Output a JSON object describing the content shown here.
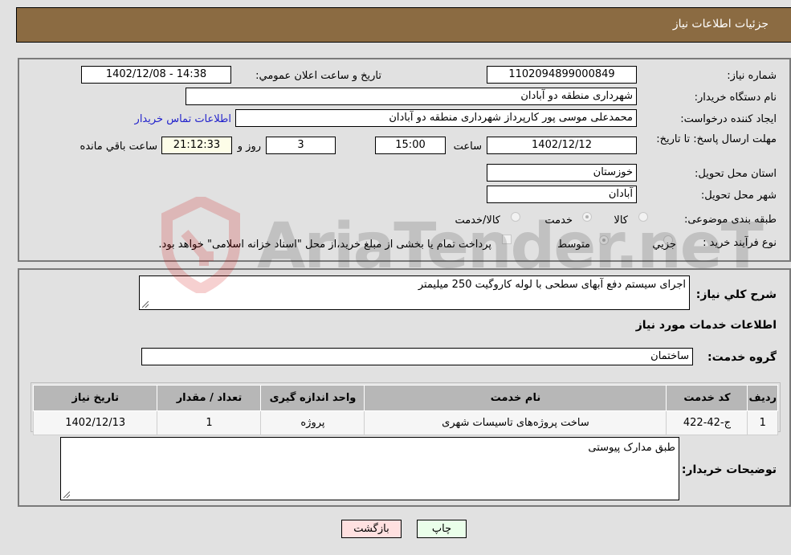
{
  "header": {
    "title": "جزئیات اطلاعات نیاز"
  },
  "form": {
    "need_number_label": "شماره نیاز:",
    "need_number": "1102094899000849",
    "announce_label": "تاریخ و ساعت اعلان عمومي:",
    "announce_value": "1402/12/08 - 14:38",
    "buyer_org_label": "نام دستگاه خریدار:",
    "buyer_org": "شهرداری منطقه دو آبادان",
    "requester_label": "ایجاد کننده درخواست:",
    "requester": "محمدعلی موسی پور کارپرداز شهرداری منطقه دو آبادان",
    "contact_link": "اطلاعات تماس خریدار",
    "deadline_label": "مهلت ارسال پاسخ: تا تاریخ:",
    "deadline_date": "1402/12/12",
    "time_label": "ساعت",
    "deadline_time": "15:00",
    "days_value": "3",
    "days_label": "روز و",
    "remaining_time": "21:12:33",
    "remaining_label": "ساعت باقي مانده",
    "province_label": "استان محل تحویل:",
    "province": "خوزستان",
    "city_label": "شهر محل تحویل:",
    "city": "آبادان",
    "category_label": "طبقه بندی موضوعی:",
    "category_options": [
      {
        "label": "کالا",
        "checked": false
      },
      {
        "label": "خدمت",
        "checked": true
      },
      {
        "label": "کالا/خدمت",
        "checked": false
      }
    ],
    "process_label": "نوع فرآیند خرید :",
    "process_options": [
      {
        "label": "جزيي",
        "checked": false
      },
      {
        "label": "متوسط",
        "checked": true
      }
    ],
    "treasury_note": "پرداخت تمام یا بخشی از مبلغ خرید،از محل \"اسناد خزانه اسلامی\" خواهد بود.",
    "treasury_checked": false
  },
  "details": {
    "description_label": "شرح كلي نياز:",
    "description": "اجرای سیستم دفع آبهای سطحی با لوله کاروگیت 250 میلیمتر",
    "services_heading": "اطلاعات خدمات مورد نیاز",
    "service_group_label": "گروه خدمت:",
    "service_group": "ساختمان",
    "table": {
      "headers": [
        "ردیف",
        "کد خدمت",
        "نام خدمت",
        "واحد اندازه گیری",
        "تعداد / مقدار",
        "تاریخ نیاز"
      ],
      "rows": [
        [
          "1",
          "ج-42-422",
          "ساخت پروژه‌های تاسیسات شهری",
          "پروژه",
          "1",
          "1402/12/13"
        ]
      ]
    },
    "buyer_notes_label": "توضیحات خریدار:",
    "buyer_notes": "طبق مدارک پیوستی"
  },
  "buttons": {
    "print": "چاپ",
    "back": "بازگشت"
  },
  "watermark": {
    "text": "AriaTender.neT"
  },
  "colors": {
    "header": "#8b6b42",
    "back_button": "#ffe0e0",
    "print_button": "#eaffea",
    "remaining_bg": "#fdfde8",
    "link": "#2222cc"
  }
}
